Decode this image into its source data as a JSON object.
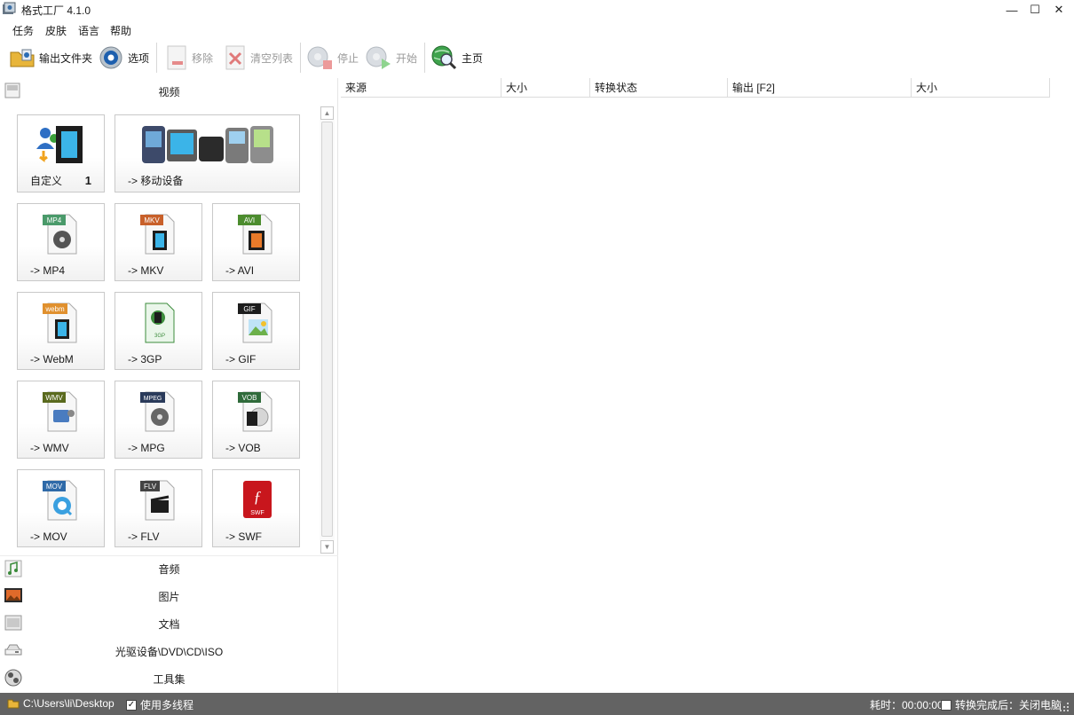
{
  "window": {
    "title": "格式工厂 4.1.0",
    "min": "—",
    "max": "☐",
    "close": "✕"
  },
  "menu": [
    "任务",
    "皮肤",
    "语言",
    "帮助"
  ],
  "toolbar": {
    "output_folder": "输出文件夹",
    "options": "选项",
    "remove": "移除",
    "clear_list": "清空列表",
    "stop": "停止",
    "start": "开始",
    "home": "主页"
  },
  "categories": {
    "video": "视频",
    "audio": "音频",
    "picture": "图片",
    "document": "文档",
    "rom": "光驱设备\\DVD\\CD\\ISO",
    "tools": "工具集"
  },
  "tiles": {
    "custom": "自定义",
    "custom_count": "1",
    "mobile": "-> 移动设备",
    "mp4": "-> MP4",
    "mkv": "-> MKV",
    "avi": "-> AVI",
    "webm": "-> WebM",
    "3gp": "-> 3GP",
    "gif": "-> GIF",
    "wmv": "-> WMV",
    "mpg": "-> MPG",
    "vob": "-> VOB",
    "mov": "-> MOV",
    "flv": "-> FLV",
    "swf": "-> SWF"
  },
  "tile_badges": {
    "mp4": "MP4",
    "mkv": "MKV",
    "avi": "AVI",
    "webm": "webm",
    "3gp": "3GP",
    "gif": "GIF",
    "wmv": "WMV",
    "mpg": "MPEG",
    "vob": "VOB",
    "mov": "MOV",
    "flv": "FLV",
    "swf": "SWF"
  },
  "table": {
    "columns": [
      "来源",
      "大小",
      "转换状态",
      "输出 [F2]",
      "大小"
    ]
  },
  "status": {
    "path": "C:\\Users\\li\\Desktop",
    "multithread": "使用多线程",
    "elapsed": "耗时：00:00:00",
    "after_convert": "转换完成后：关闭电脑"
  }
}
